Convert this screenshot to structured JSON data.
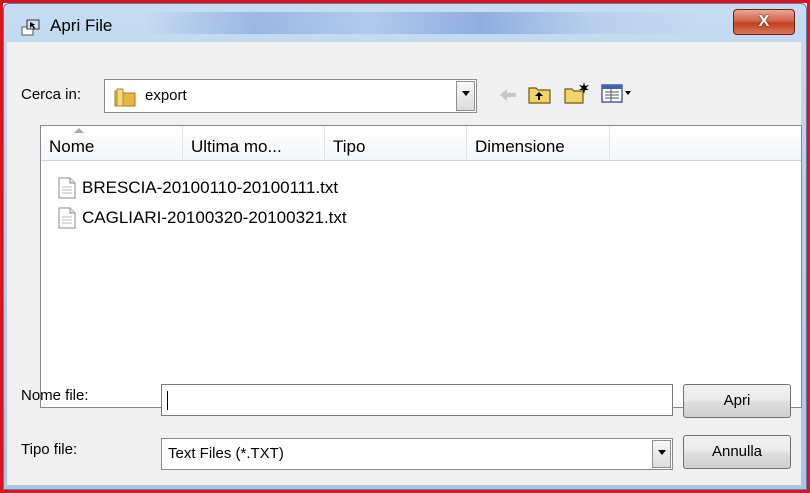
{
  "window": {
    "title": "Apri File",
    "close_glyph": "X"
  },
  "look_in": {
    "label": "Cerca in:",
    "value": "export"
  },
  "columns": [
    {
      "label": "Nome"
    },
    {
      "label": "Ultima mo..."
    },
    {
      "label": "Tipo"
    },
    {
      "label": "Dimensione"
    }
  ],
  "files": [
    {
      "name": "BRESCIA-20100110-20100111.txt"
    },
    {
      "name": "CAGLIARI-20100320-20100321.txt"
    }
  ],
  "filename": {
    "label": "Nome file:",
    "value": ""
  },
  "filetype": {
    "label": "Tipo file:",
    "value": "Text Files (*.TXT)"
  },
  "buttons": {
    "open": "Apri",
    "cancel": "Annulla"
  },
  "icons": {
    "app": "dialog-icon",
    "folder": "folder-icon",
    "back": "back-arrow-icon",
    "up": "up-folder-icon",
    "new_folder": "new-folder-icon",
    "views": "view-menu-icon",
    "file": "text-file-icon"
  }
}
